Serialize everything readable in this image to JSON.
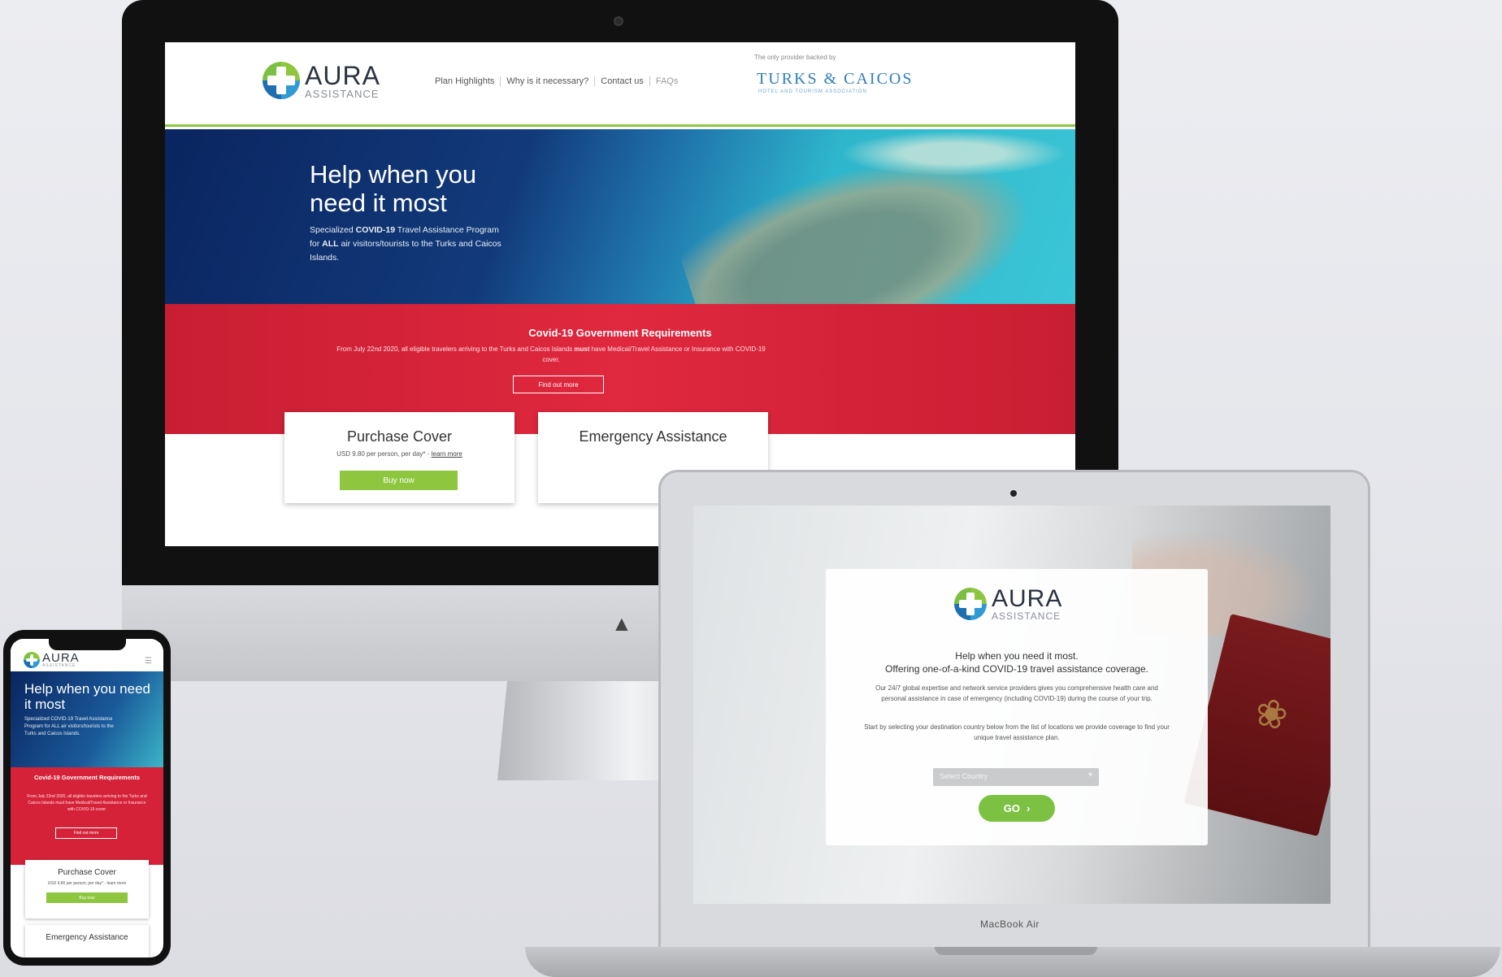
{
  "brand": {
    "name": "AURA",
    "sub": "ASSISTANCE",
    "accent_green": "#8ec63f",
    "accent_red": "#d52238",
    "navy": "#0a2560"
  },
  "desktop": {
    "nav": [
      "Plan Highlights",
      "Why is it necessary?",
      "Contact us",
      "FAQs"
    ],
    "partner_tag": "The only provider backed by",
    "partner_logo": "TURKS & CAICOS",
    "partner_sub": "HOTEL AND TOURISM ASSOCIATION",
    "hero": {
      "title": "Help when you need it most",
      "text_pre": "Specialized ",
      "text_bold1": "COVID-19",
      "text_mid": " Travel Assistance Program for ",
      "text_bold2": "ALL",
      "text_post": " air visitors/tourists to the Turks and Caicos Islands."
    },
    "requirements": {
      "title": "Covid-19 Government Requirements",
      "text_pre": "From July 22nd 2020, all eligible travelers arriving to the Turks and Caicos Islands ",
      "text_bold": "must",
      "text_post": " have Medical/Travel Assistance or Insurance with COVID-19 cover.",
      "button": "Find out more"
    },
    "cards": [
      {
        "title": "Purchase Cover",
        "sub": "USD 9.80 per person, per day* - ",
        "link": "learn more",
        "button": "Buy now"
      },
      {
        "title": "Emergency Assistance"
      }
    ],
    "stand_logo": "apple-logo-icon"
  },
  "laptop": {
    "label": "MacBook Air",
    "headline1": "Help when you need it most.",
    "headline2": "Offering one-of-a-kind COVID-19 travel assistance coverage.",
    "body1": "Our 24/7 global expertise and network service providers gives you comprehensive health care and personal assistance in case of emergency (including COVID-19) during the course of your trip.",
    "body2": "Start by selecting your destination country below from the list of locations we provide coverage to find your unique travel assistance plan.",
    "select_placeholder": "Select Country",
    "go": "GO",
    "go_icon": "chevron-right-icon"
  },
  "phone": {
    "hero_title": "Help when you need it most",
    "hero_text": "Specialized COVID-19 Travel Assistance Program for ALL air visitors/tourists to the Turks and Caicos Islands.",
    "req_title": "Covid-19 Government Requirements",
    "req_text": "From July 22nd 2020, all eligible travelers arriving to the Turks and Caicos Islands must have Medical/Travel Assistance or Insurance with COVID-19 cover.",
    "req_button": "Find out more",
    "card1_title": "Purchase Cover",
    "card1_sub": "USD 9.80 per person, per day* - learn more",
    "card1_button": "Buy now",
    "card2_title": "Emergency Assistance"
  }
}
